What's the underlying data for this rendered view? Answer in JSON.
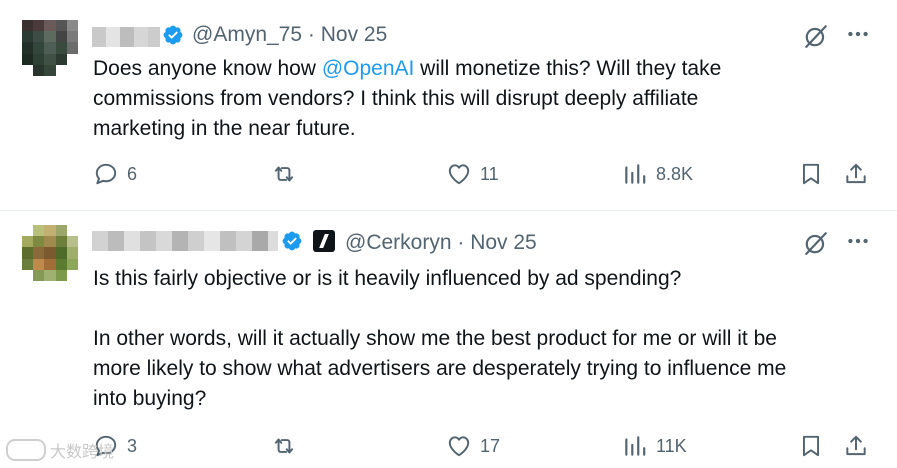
{
  "tweets": [
    {
      "handle": "@Amyn_75",
      "sep": "·",
      "date": "Nov 25",
      "text_before": "Does anyone know how ",
      "mention": "@OpenAI",
      "text_after": " will monetize this? Will they take\ncommissions from vendors?  I think this will disrupt deeply affiliate\nmarketing in the near future.",
      "replies": "6",
      "likes": "11",
      "views": "8.8K"
    },
    {
      "handle": "@Cerkoryn",
      "sep": "·",
      "date": "Nov 25",
      "text": "Is this fairly objective or is it heavily influenced by ad spending?\n\nIn other words, will it actually show me the best product for me or will it be\nmore likely to show what advertisers are desperately trying to influence me\ninto buying?",
      "replies": "3",
      "likes": "17",
      "views": "11K"
    }
  ],
  "watermark": "大数跨境",
  "colors": {
    "accent": "#1d9bf0",
    "muted": "#536471",
    "text": "#0f1419"
  }
}
